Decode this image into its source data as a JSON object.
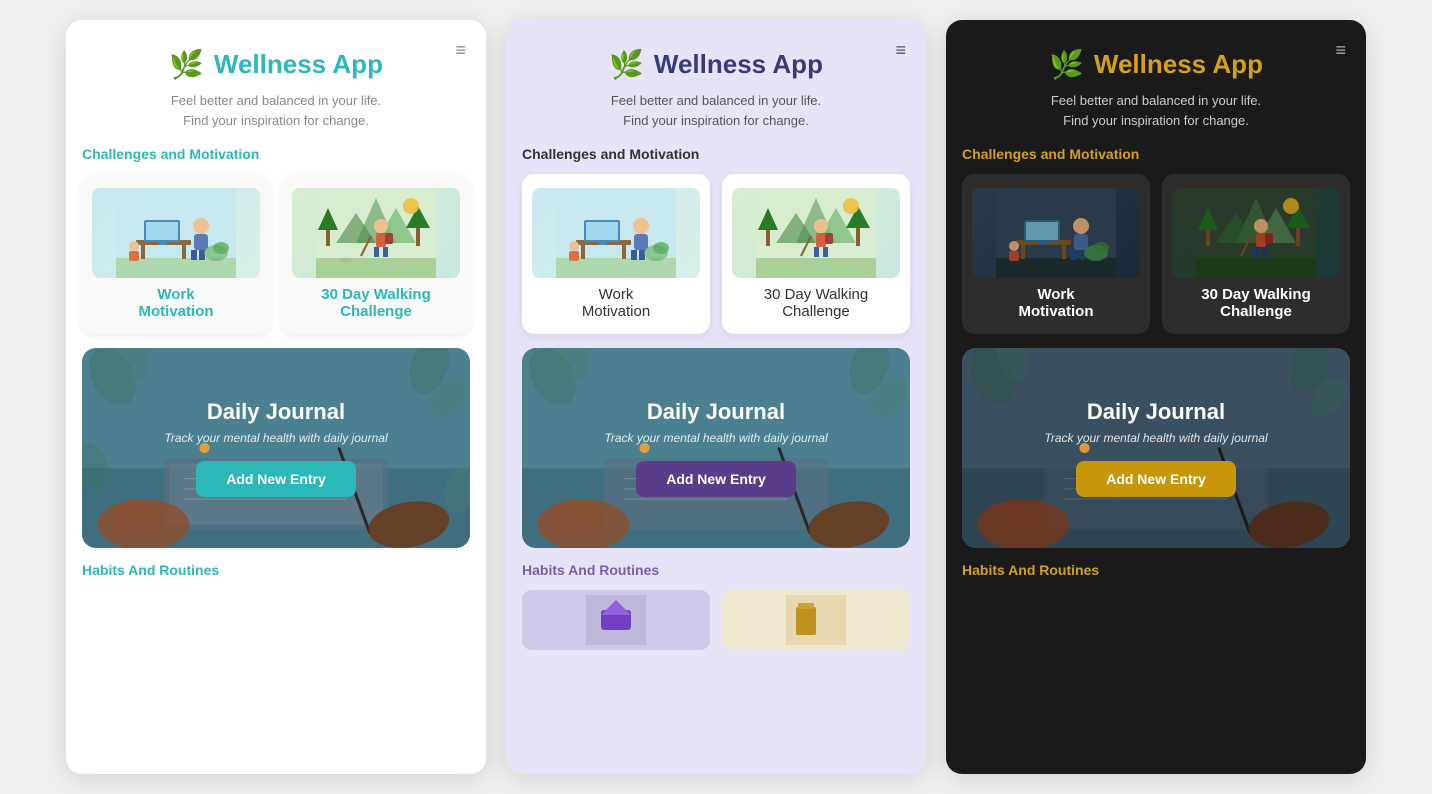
{
  "themes": [
    "light",
    "purple",
    "dark"
  ],
  "phones": [
    {
      "theme": "light",
      "header": {
        "logo_icon": "🌿",
        "title": "Wellness App",
        "subtitle_line1": "Feel better and balanced in your life.",
        "subtitle_line2": "Find your inspiration for change.",
        "menu_icon": "≡"
      },
      "section_challenges": "Challenges and Motivation",
      "cards": [
        {
          "id": "work-motivation",
          "title": "Work\nMotivation",
          "illus_type": "work"
        },
        {
          "id": "walking-challenge",
          "title": "30 Day Walking\nChallenge",
          "illus_type": "walk"
        }
      ],
      "journal": {
        "title": "Daily Journal",
        "subtitle": "Track your mental health with daily journal",
        "button_label": "Add New Entry"
      },
      "section_habits": "Habits And Routines"
    },
    {
      "theme": "purple",
      "header": {
        "logo_icon": "🌿",
        "title": "Wellness App",
        "subtitle_line1": "Feel better and balanced in your life.",
        "subtitle_line2": "Find your inspiration for change.",
        "menu_icon": "≡"
      },
      "section_challenges": "Challenges and Motivation",
      "cards": [
        {
          "id": "work-motivation",
          "title": "Work\nMotivation",
          "illus_type": "work"
        },
        {
          "id": "walking-challenge",
          "title": "30 Day Walking\nChallenge",
          "illus_type": "walk"
        }
      ],
      "journal": {
        "title": "Daily Journal",
        "subtitle": "Track your mental health with daily journal",
        "button_label": "Add New Entry"
      },
      "section_habits": "Habits And Routines"
    },
    {
      "theme": "dark",
      "header": {
        "logo_icon": "🌿",
        "title": "Wellness App",
        "subtitle_line1": "Feel better and balanced in your life.",
        "subtitle_line2": "Find your inspiration for change.",
        "menu_icon": "≡"
      },
      "section_challenges": "Challenges and Motivation",
      "cards": [
        {
          "id": "work-motivation",
          "title": "Work\nMotivation",
          "illus_type": "work"
        },
        {
          "id": "walking-challenge",
          "title": "30 Day Walking\nChallenge",
          "illus_type": "walk"
        }
      ],
      "journal": {
        "title": "Daily Journal",
        "subtitle": "Track your mental health with daily journal",
        "button_label": "Add New Entry"
      },
      "section_habits": "Habits And Routines"
    }
  ]
}
